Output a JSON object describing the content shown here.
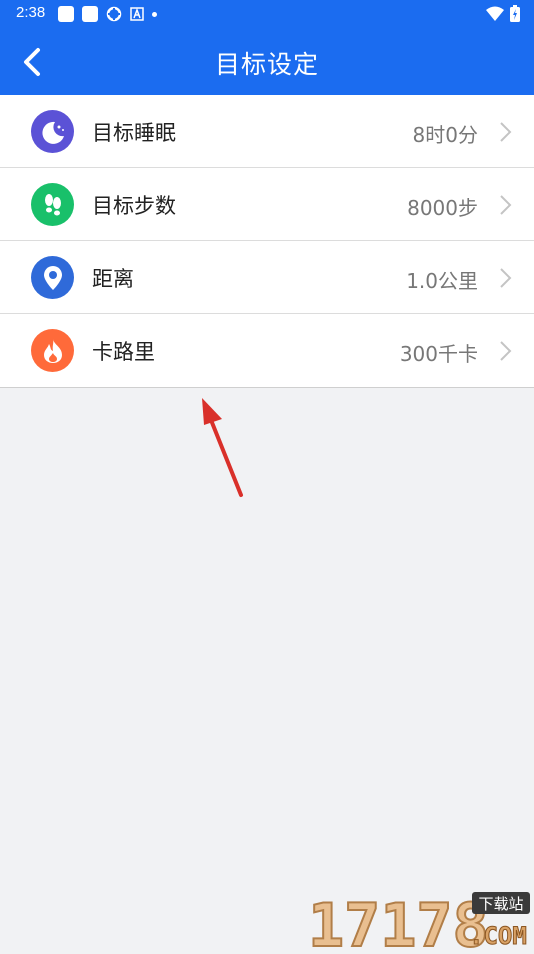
{
  "status_bar": {
    "time": "2:38"
  },
  "header": {
    "title": "目标设定"
  },
  "goals": [
    {
      "label": "目标睡眠",
      "value": "8时0分",
      "icon": "moon-icon",
      "color": "#5b52d6"
    },
    {
      "label": "目标步数",
      "value": "8000步",
      "icon": "footprints-icon",
      "color": "#19c06a"
    },
    {
      "label": "距离",
      "value": "1.0公里",
      "icon": "location-pin-icon",
      "color": "#2f6ad9"
    },
    {
      "label": "卡路里",
      "value": "300千卡",
      "icon": "flame-icon",
      "color": "#ff6a3a"
    }
  ],
  "watermark": {
    "number": "17178",
    "site_tag": "下载站",
    "domain": ".COM"
  }
}
